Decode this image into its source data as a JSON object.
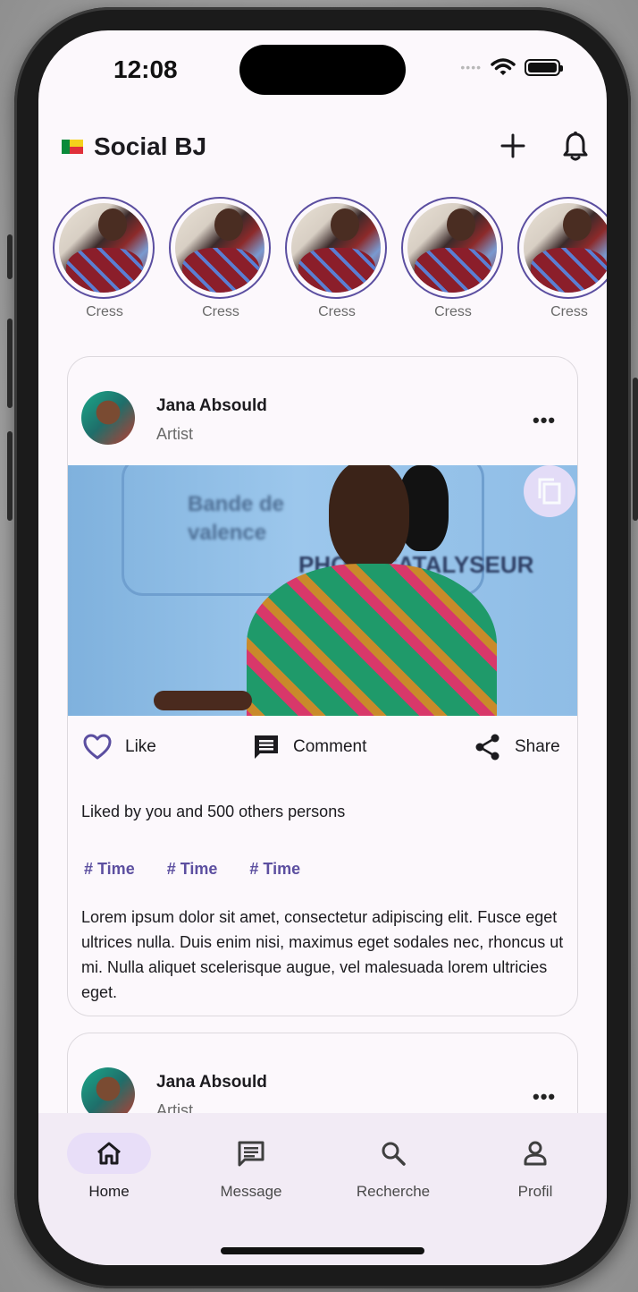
{
  "status_bar": {
    "time": "12:08"
  },
  "app": {
    "title": "Social BJ"
  },
  "stories": [
    {
      "name": "Cress"
    },
    {
      "name": "Cress"
    },
    {
      "name": "Cress"
    },
    {
      "name": "Cress"
    },
    {
      "name": "Cress"
    }
  ],
  "posts": [
    {
      "author": "Jana Absould",
      "role": "Artist",
      "actions": {
        "like": "Like",
        "comment": "Comment",
        "share": "Share"
      },
      "liked_text": "Liked by you and 500 others persons",
      "tags": [
        "# Time",
        "# Time",
        "# Time"
      ],
      "body": "Lorem ipsum dolor sit amet, consectetur adipiscing elit. Fusce eget ultrices nulla. Duis enim nisi, maximus eget sodales nec, rhoncus ut mi. Nulla aliquet scelerisque augue, vel malesuada lorem ultricies eget.",
      "image_text": {
        "line1": "Bande de",
        "line2": "valence",
        "line3": "PHOTOCATALYSEUR"
      }
    },
    {
      "author": "Jana Absould",
      "role": "Artist"
    }
  ],
  "nav": {
    "items": [
      {
        "label": "Home",
        "icon": "home-icon",
        "active": true
      },
      {
        "label": "Message",
        "icon": "message-icon"
      },
      {
        "label": "Recherche",
        "icon": "search-icon"
      },
      {
        "label": "Profil",
        "icon": "person-icon"
      }
    ]
  },
  "colors": {
    "accent": "#5b4ea0",
    "nav_active": "#e8def8",
    "background": "#fcf8fc"
  }
}
